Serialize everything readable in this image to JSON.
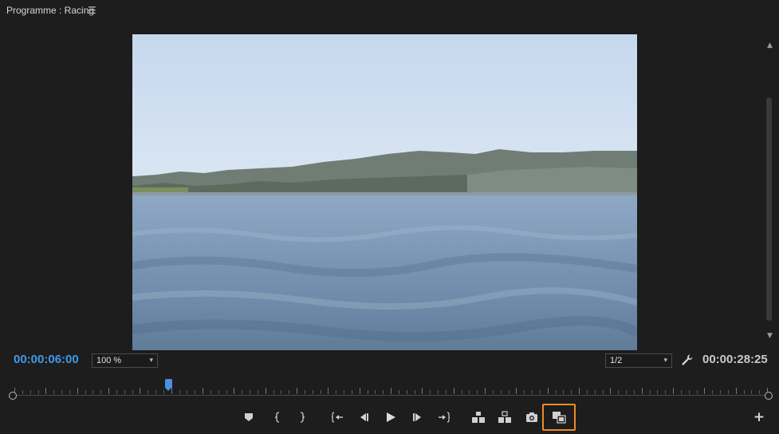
{
  "panel": {
    "title": "Programme : Racing",
    "menu_icon": "hamburger-icon"
  },
  "timecode": {
    "current": "00:00:06:00",
    "duration": "00:00:28:25",
    "current_color": "#3d9be9"
  },
  "zoom": {
    "value": "100 %"
  },
  "resolution": {
    "value": "1/2"
  },
  "playhead_position_fraction": 0.204,
  "controls": [
    {
      "name": "add-marker-button",
      "icon": "marker-icon"
    },
    {
      "name": "mark-in-button",
      "icon": "brace-left-icon"
    },
    {
      "name": "mark-out-button",
      "icon": "brace-right-icon"
    },
    {
      "name": "go-to-in-button",
      "icon": "go-to-in-icon"
    },
    {
      "name": "step-back-button",
      "icon": "step-back-icon"
    },
    {
      "name": "play-button",
      "icon": "play-icon"
    },
    {
      "name": "step-forward-button",
      "icon": "step-forward-icon"
    },
    {
      "name": "go-to-out-button",
      "icon": "go-to-out-icon"
    },
    {
      "name": "lift-button",
      "icon": "lift-icon"
    },
    {
      "name": "extract-button",
      "icon": "extract-icon"
    },
    {
      "name": "export-frame-button",
      "icon": "camera-icon"
    },
    {
      "name": "comparison-view-button",
      "icon": "comparison-view-icon",
      "highlighted": true,
      "highlight_color": "#f08a24"
    }
  ],
  "add_button": {
    "label": "+"
  }
}
